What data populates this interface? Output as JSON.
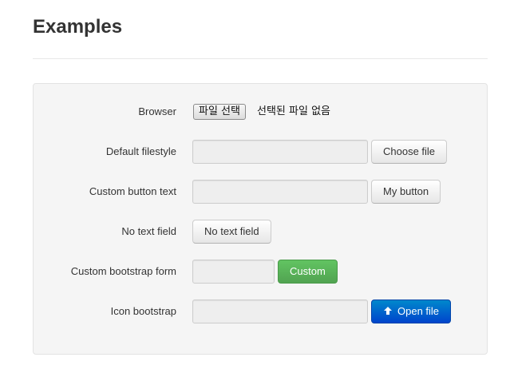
{
  "page": {
    "title": "Examples"
  },
  "rows": {
    "browser": {
      "label": "Browser",
      "button_label": "파일 선택",
      "status_text": "선택된 파일 없음"
    },
    "default_filestyle": {
      "label": "Default filestyle",
      "button_label": "Choose file"
    },
    "custom_button_text": {
      "label": "Custom button text",
      "button_label": "My button"
    },
    "no_text_field": {
      "label": "No text field",
      "button_label": "No text field"
    },
    "custom_bootstrap_form": {
      "label": "Custom bootstrap form",
      "button_label": "Custom"
    },
    "icon_bootstrap": {
      "label": "Icon bootstrap",
      "button_label": "Open file",
      "icon": "arrow-up-icon"
    }
  },
  "colors": {
    "success_button": "#5bb75b",
    "primary_button": "#0066cc",
    "panel_background": "#f5f5f5"
  }
}
